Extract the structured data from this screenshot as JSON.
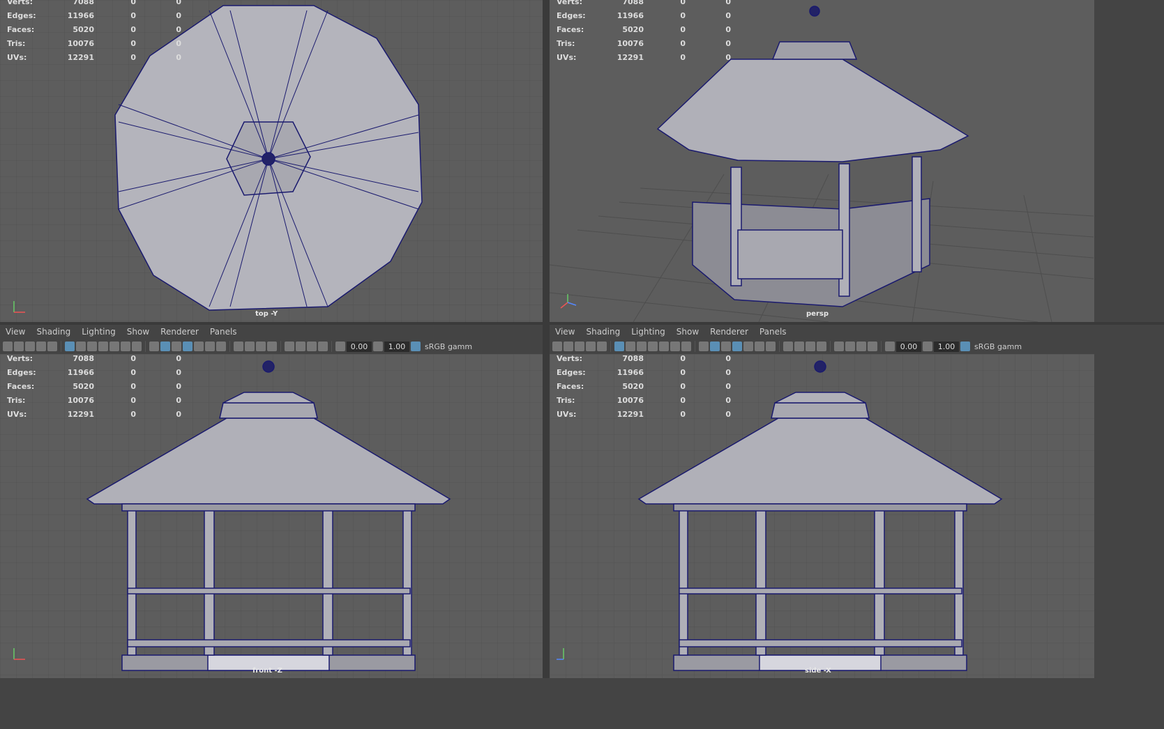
{
  "menus": [
    "View",
    "Shading",
    "Lighting",
    "Show",
    "Renderer",
    "Panels"
  ],
  "toolbar": {
    "field_a": "0.00",
    "field_b": "1.00",
    "gamma": "sRGB gamm"
  },
  "hud_labels": {
    "verts": "Verts:",
    "edges": "Edges:",
    "faces": "Faces:",
    "tris": "Tris:",
    "uvs": "UVs:"
  },
  "hud_values": {
    "verts": "7088",
    "edges": "11966",
    "faces": "5020",
    "tris": "10076",
    "uvs": "12291",
    "zero": "0"
  },
  "cameras": {
    "top": "top -Y",
    "persp": "persp",
    "front": "front -Z",
    "side": "side -X"
  },
  "colors": {
    "viewport_bg": "#5d5d5d",
    "grid": "#525252",
    "wire": "#1a1a6e",
    "model": "#b0b0b8"
  }
}
